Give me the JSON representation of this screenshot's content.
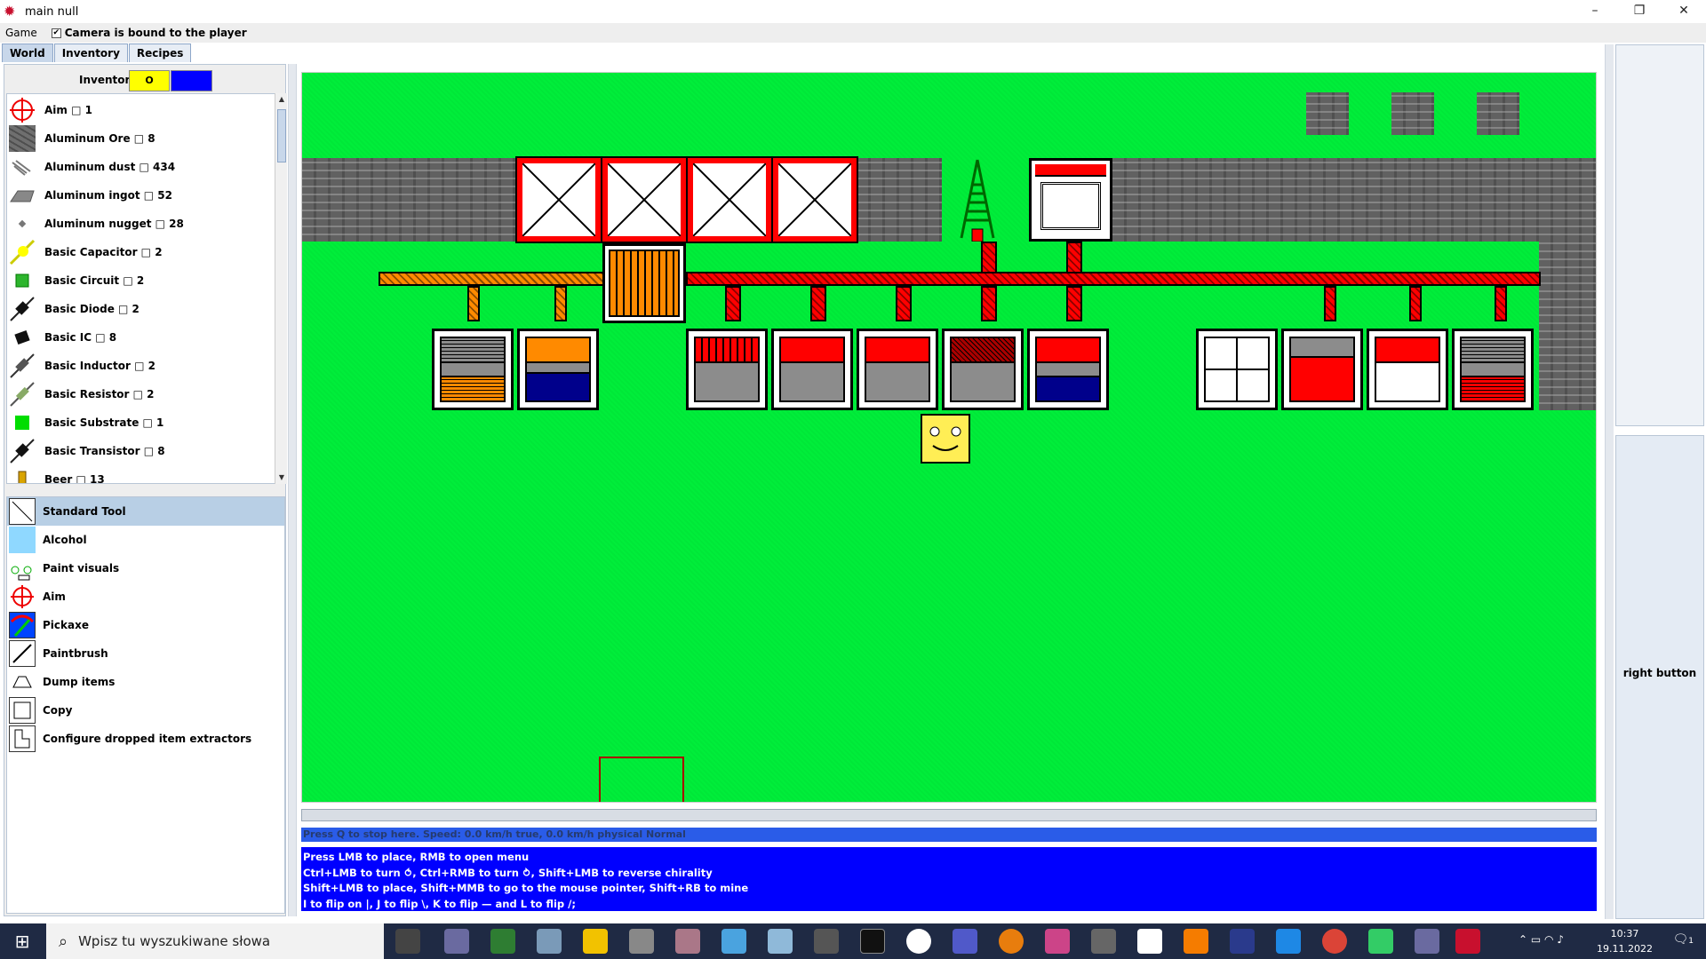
{
  "window": {
    "title": "main null",
    "controls": {
      "minimize": "–",
      "restore": "❐",
      "close": "✕"
    }
  },
  "menubar": {
    "game": "Game",
    "camera_bound_label": "Camera is bound to the player",
    "camera_bound_checked": true
  },
  "tabs": [
    {
      "label": "World",
      "active": true
    },
    {
      "label": "Inventory",
      "active": false
    },
    {
      "label": "Recipes",
      "active": false
    }
  ],
  "inventory": {
    "header_label": "Inventory",
    "swatch_text": "O",
    "items": [
      {
        "label": "Aim □ 1",
        "icon": "crosshair-icon"
      },
      {
        "label": "Aluminum Ore □ 8",
        "icon": "ore-icon"
      },
      {
        "label": "Aluminum dust □ 434",
        "icon": "dust-icon"
      },
      {
        "label": "Aluminum ingot □ 52",
        "icon": "ingot-icon"
      },
      {
        "label": "Aluminum nugget □ 28",
        "icon": "nugget-icon"
      },
      {
        "label": "Basic Capacitor □ 2",
        "icon": "capacitor-icon"
      },
      {
        "label": "Basic Circuit □ 2",
        "icon": "circuit-icon"
      },
      {
        "label": "Basic Diode □ 2",
        "icon": "diode-icon"
      },
      {
        "label": "Basic IC □ 8",
        "icon": "ic-icon"
      },
      {
        "label": "Basic Inductor □ 2",
        "icon": "inductor-icon"
      },
      {
        "label": "Basic Resistor □ 2",
        "icon": "resistor-icon"
      },
      {
        "label": "Basic Substrate □ 1",
        "icon": "substrate-icon"
      },
      {
        "label": "Basic Transistor □ 8",
        "icon": "transistor-icon"
      },
      {
        "label": "Beer □ 13",
        "icon": "beer-icon"
      }
    ]
  },
  "tools": [
    {
      "label": "Standard Tool",
      "icon": "standard-tool-icon",
      "selected": true
    },
    {
      "label": "Alcohol",
      "icon": "alcohol-icon",
      "selected": false
    },
    {
      "label": "Paint visuals",
      "icon": "paint-visuals-icon",
      "selected": false
    },
    {
      "label": "Aim",
      "icon": "crosshair-icon",
      "selected": false
    },
    {
      "label": "Pickaxe",
      "icon": "pickaxe-icon",
      "selected": false
    },
    {
      "label": "Paintbrush",
      "icon": "paintbrush-icon",
      "selected": false
    },
    {
      "label": "Dump items",
      "icon": "dump-icon",
      "selected": false
    },
    {
      "label": "Copy",
      "icon": "copy-icon",
      "selected": false
    },
    {
      "label": "Configure dropped item extractors",
      "icon": "extractor-config-icon",
      "selected": false
    }
  ],
  "status": {
    "line": "Press Q to stop here. Speed: 0.0 km/h true, 0.0 km/h physical Normal",
    "help": [
      "Press LMB to place, RMB to open menu",
      "Ctrl+LMB to turn ⥀, Ctrl+RMB to turn ⥁, Shift+LMB to reverse chirality",
      "Shift+LMB to place, Shift+MMB to go to the mouse pointer, Shift+RB to mine",
      "I to flip on |, J to flip \\, K to flip — and L to flip /;"
    ]
  },
  "right_panel": {
    "button_label": "right button"
  },
  "taskbar": {
    "search_placeholder": "Wpisz tu wyszukiwane słowa",
    "time": "10:37",
    "date": "19.11.2022",
    "notification_count": "1"
  },
  "colors": {
    "grass": "#00ee3a",
    "stone": "#616161",
    "pipe_red": "#ff0000",
    "pipe_orange": "#ff8a00",
    "help_bg": "#0000ff",
    "status_bg": "#2a5ce8"
  }
}
